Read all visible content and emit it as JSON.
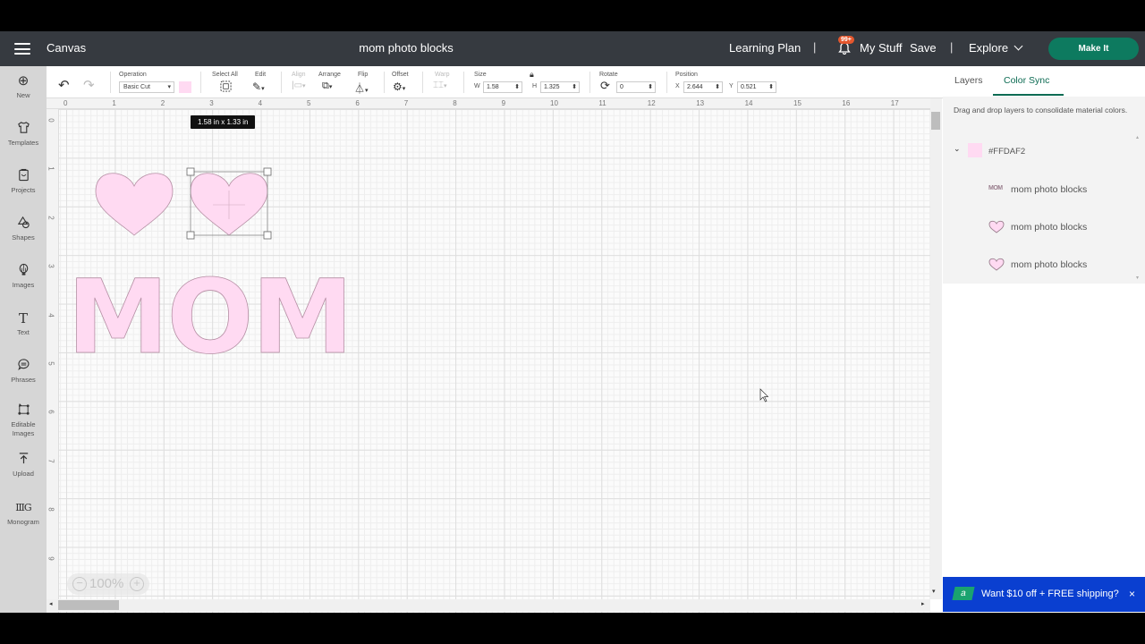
{
  "topbar": {
    "app_name": "Canvas",
    "doc_title": "mom photo blocks",
    "learning_plan": "Learning Plan",
    "separator": "|",
    "notification_badge": "99+",
    "my_stuff": "My Stuff",
    "save": "Save",
    "explore": "Explore",
    "make_it": "Make It"
  },
  "toolbar": {
    "operation_label": "Operation",
    "operation_value": "Basic Cut",
    "material_color": "#FFDAF2",
    "select_all_label": "Select All",
    "edit_label": "Edit",
    "align_label": "Align",
    "arrange_label": "Arrange",
    "flip_label": "Flip",
    "offset_label": "Offset",
    "warp_label": "Warp",
    "size_label": "Size",
    "w_label": "W",
    "w_value": "1.58",
    "h_label": "H",
    "h_value": "1.325",
    "rotate_label": "Rotate",
    "rotate_value": "0",
    "position_label": "Position",
    "x_label": "X",
    "x_value": "2.644",
    "y_label": "Y",
    "y_value": "0.521"
  },
  "sidebar": {
    "items": [
      {
        "label": "New",
        "icon": "plus-circle-icon"
      },
      {
        "label": "Templates",
        "icon": "shirt-icon"
      },
      {
        "label": "Projects",
        "icon": "projects-icon"
      },
      {
        "label": "Shapes",
        "icon": "shapes-icon"
      },
      {
        "label": "Images",
        "icon": "lightbulb-icon"
      },
      {
        "label": "Text",
        "icon": "text-icon"
      },
      {
        "label": "Phrases",
        "icon": "speech-bubble-icon"
      },
      {
        "label": "Editable Images",
        "icon": "editable-images-icon"
      },
      {
        "label": "Upload",
        "icon": "upload-icon"
      },
      {
        "label": "Monogram",
        "icon": "monogram-icon"
      }
    ]
  },
  "canvas": {
    "ruler_h": [
      "0",
      "1",
      "2",
      "3",
      "4",
      "5",
      "6",
      "7",
      "8",
      "9",
      "10",
      "11",
      "12",
      "13",
      "14",
      "15",
      "16",
      "17"
    ],
    "ruler_v": [
      "0",
      "1",
      "2",
      "3",
      "4",
      "5",
      "6",
      "7",
      "8",
      "9"
    ],
    "selection_tooltip": "1.58  in x 1.33  in",
    "mom_text": "MOM",
    "shape_color": "#FFDAF2",
    "zoom_level": "100%"
  },
  "panel": {
    "tabs": [
      "Layers",
      "Color Sync"
    ],
    "active_tab": "Color Sync",
    "description": "Drag and drop layers to consolidate material colors.",
    "color_group": "#FFDAF2",
    "layers": [
      {
        "thumb": "MOM",
        "name": "mom photo blocks"
      },
      {
        "thumb": "heart",
        "name": "mom photo blocks"
      },
      {
        "thumb": "heart",
        "name": "mom photo blocks"
      }
    ]
  },
  "promo": {
    "text": "Want $10 off + FREE shipping?",
    "close": "×"
  }
}
